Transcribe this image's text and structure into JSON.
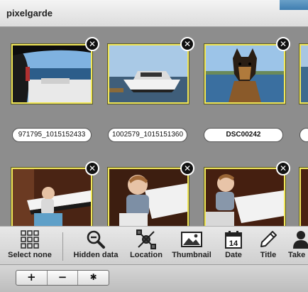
{
  "app": {
    "title": "pixelgarde"
  },
  "photos": [
    {
      "name": "971795_1015152433",
      "close": "✕"
    },
    {
      "name": "1002579_1015151360",
      "close": "✕"
    },
    {
      "name": "DSC00242",
      "close": "✕"
    },
    {
      "name": "",
      "close": "✕"
    },
    {
      "name": "",
      "close": "✕"
    },
    {
      "name": "",
      "close": "✕"
    }
  ],
  "toolbar": {
    "select_none": "Select none",
    "hidden_data": "Hidden data",
    "location": "Location",
    "thumbnail": "Thumbnail",
    "date": "Date",
    "date_icon_day": "14",
    "title": "Title",
    "take": "Take"
  },
  "bottombar": {
    "add": "+",
    "remove": "−",
    "settings": "✱"
  },
  "colors": {
    "selection_border": "#f0e65a",
    "background": "#8d8d8d"
  }
}
